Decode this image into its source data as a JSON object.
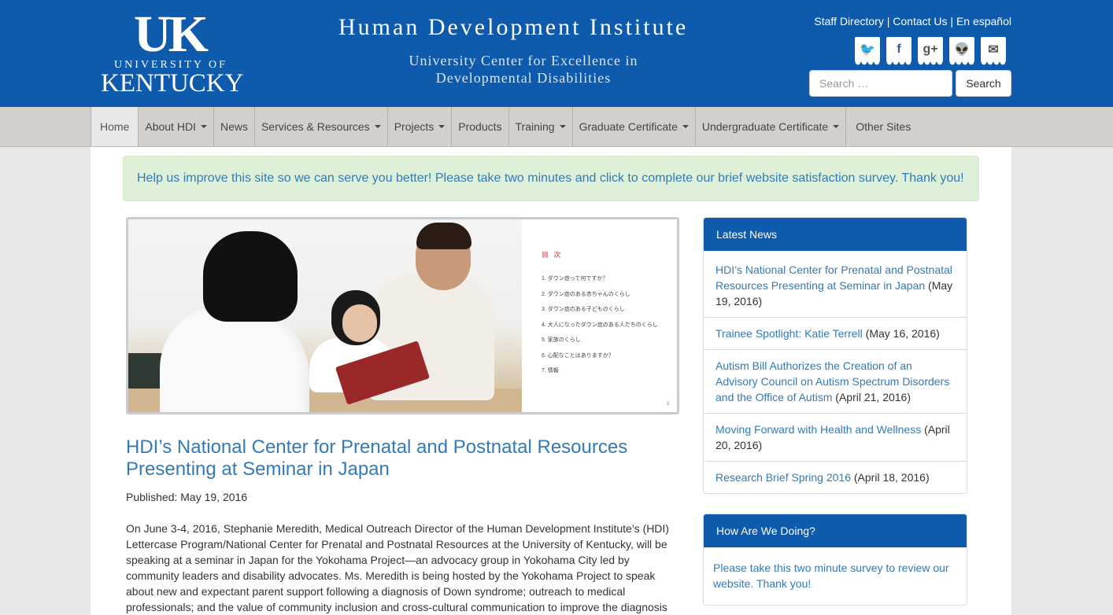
{
  "header": {
    "uk_mark": "UK",
    "uk_university": "UNIVERSITY OF",
    "uk_kentucky": "KENTUCKY",
    "title": "Human Development Institute",
    "subtitle_line1": "University Center for Excellence in",
    "subtitle_line2": "Developmental Disabilities",
    "util_links": [
      "Staff Directory",
      "Contact Us",
      "En español"
    ],
    "util_separator": " | ",
    "social": [
      {
        "name": "twitter-icon",
        "glyph": "🐦",
        "color": "#55acee"
      },
      {
        "name": "facebook-icon",
        "glyph": "f",
        "color": "#3b5998"
      },
      {
        "name": "google-plus-icon",
        "glyph": "g+",
        "color": "#555555"
      },
      {
        "name": "reddit-icon",
        "glyph": "👽",
        "color": "#ff4500"
      },
      {
        "name": "email-icon",
        "glyph": "✉",
        "color": "#555555"
      }
    ],
    "search": {
      "placeholder": "Search …",
      "button": "Search"
    }
  },
  "nav": {
    "items": [
      {
        "label": "Home",
        "dropdown": false,
        "active": true
      },
      {
        "label": "About HDI",
        "dropdown": true
      },
      {
        "label": "News",
        "dropdown": false
      },
      {
        "label": "Services & Resources",
        "dropdown": true
      },
      {
        "label": "Projects",
        "dropdown": true
      },
      {
        "label": "Products",
        "dropdown": false
      },
      {
        "label": "Training",
        "dropdown": true
      },
      {
        "label": "Graduate Certificate",
        "dropdown": true
      },
      {
        "label": "Undergraduate Certificate",
        "dropdown": true
      },
      {
        "label": "Other Sites",
        "dropdown": false
      }
    ]
  },
  "alert": {
    "text": "Help us improve this site so we can serve you better! Please take two minutes and click to complete our brief website satisfaction survey. Thank you!"
  },
  "hero": {
    "toc_title": "目 次",
    "toc_items": [
      "1. ダウン症って何ですか？",
      "2. ダウン症のある赤ちゃんのくらし",
      "3. ダウン症のある子どものくらし",
      "4. 大人になったダウン症のある人たちのくらし",
      "5. 家族のくらし",
      "6. 心配なことはありますか？",
      "7. 情報"
    ],
    "page_number": "3"
  },
  "article": {
    "title": "HDI’s National Center for Prenatal and Postnatal Resources Presenting at Seminar in Japan",
    "published": "Published: May 19, 2016",
    "body": "On June 3-4, 2016, Stephanie Meredith, Medical Outreach Director of the Human Development Institute’s (HDI) Lettercase Program/National Center for Prenatal and Postnatal Resources at the University of Kentucky, will be speaking at a seminar in Japan for the Yokohama Project—an advocacy group in Yokohama City led by community leaders and disability advocates. Ms. Meredith is being hosted by the Yokohama Project to speak about new and expectant parent support following a diagnosis of Down syndrome; outreach to medical professionals; and the value of community inclusion and cross-cultural communication to improve the diagnosis"
  },
  "latest_news": {
    "heading": "Latest News",
    "items": [
      {
        "title": "HDI’s National Center for Prenatal and Postnatal Resources Presenting at Seminar in Japan",
        "date": " (May 19, 2016)"
      },
      {
        "title": "Trainee Spotlight: Katie Terrell",
        "date": " (May 16, 2016)"
      },
      {
        "title": "Autism Bill Authorizes the Creation of an Advisory Council on Autism Spectrum Disorders and the Office of Autism",
        "date": " (April 21, 2016)"
      },
      {
        "title": "Moving Forward with Health and Wellness",
        "date": " (April 20, 2016)"
      },
      {
        "title": "Research Brief Spring 2016",
        "date": " (April 18, 2016)"
      }
    ]
  },
  "survey": {
    "heading": "How Are We Doing?",
    "text": "Please take this two minute survey to review our website. Thank you!"
  }
}
